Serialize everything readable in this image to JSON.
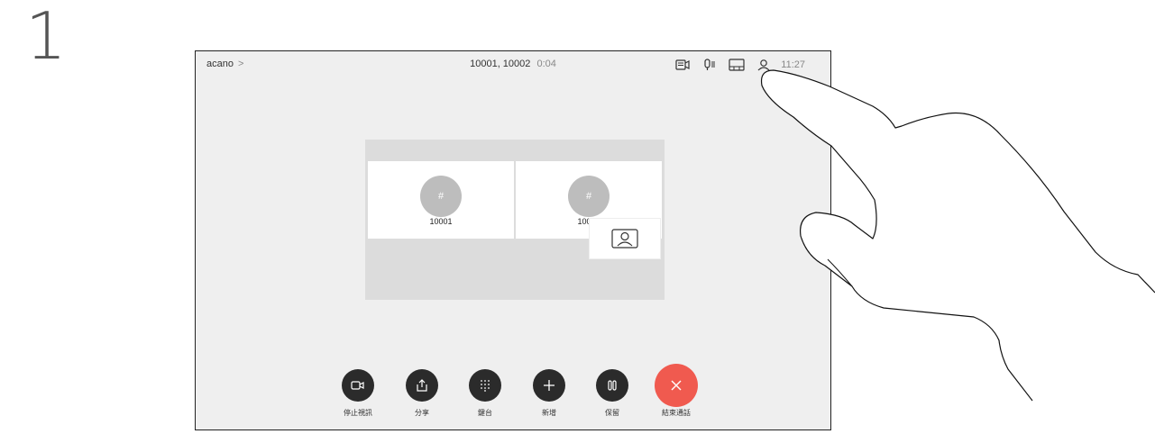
{
  "step": "1",
  "topbar": {
    "brand": "acano",
    "brand_chevron": ">",
    "call_participants": "10001, 10002",
    "call_duration": "0:04",
    "time": "11:27",
    "icons": [
      "self-view-icon",
      "microphone-icon",
      "layout-icon",
      "participants-icon"
    ]
  },
  "participants": [
    {
      "avatar_initials": "#",
      "label": "10001"
    },
    {
      "avatar_initials": "#",
      "label": "10002"
    }
  ],
  "controls": [
    {
      "label": "停止視訊",
      "icon": "camera-icon"
    },
    {
      "label": "分享",
      "icon": "share-icon"
    },
    {
      "label": "鍵台",
      "icon": "keypad-icon"
    },
    {
      "label": "新增",
      "icon": "plus-icon"
    },
    {
      "label": "保留",
      "icon": "hold-icon"
    },
    {
      "label": "結束通話",
      "icon": "end-call-icon"
    }
  ],
  "colors": {
    "end_call": "#f05a4f",
    "button": "#2b2b2b",
    "avatar": "#bdbdbd"
  }
}
